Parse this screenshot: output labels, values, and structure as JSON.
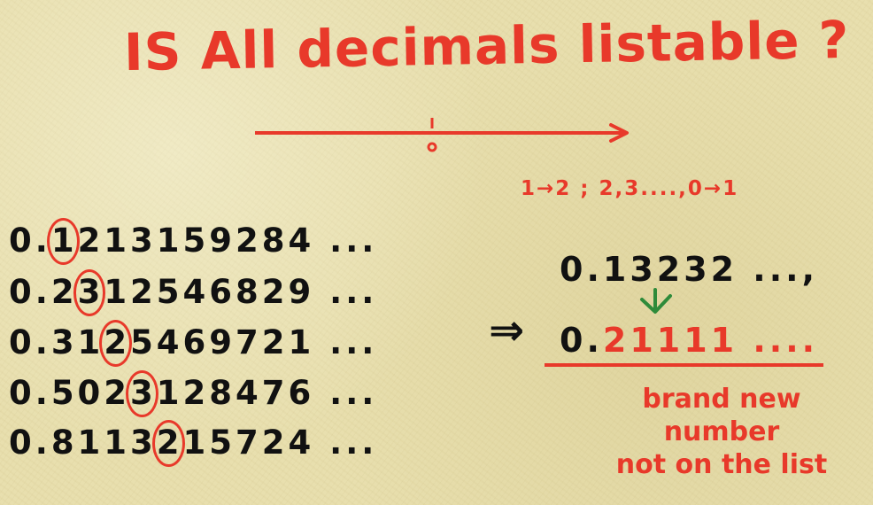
{
  "title": "IS All decimals listable ?",
  "rule": "1→2 ; 2,3....,0→1",
  "list": {
    "rows": [
      {
        "prefix": "0.",
        "circled": "1",
        "after": "213159284 ...",
        "before": ""
      },
      {
        "prefix": "0.",
        "before": "2",
        "circled": "3",
        "after": "12546829 ..."
      },
      {
        "prefix": "0.",
        "before": "31",
        "circled": "2",
        "after": "5469721 ..."
      },
      {
        "prefix": "0.",
        "before": "502",
        "circled": "3",
        "after": "128476 ..."
      },
      {
        "prefix": "0.",
        "before": "8113",
        "circled": "2",
        "after": "15724 ..."
      }
    ]
  },
  "implies": "⇒",
  "diagonal_number": "0.13232 ...,",
  "new_number": {
    "prefix": "0.",
    "first": "2",
    "rest": "1111 ...."
  },
  "caption": {
    "line1": "brand new",
    "line2": "number",
    "line3": "not on the list"
  },
  "colors": {
    "accent": "#e8392a",
    "ink": "#111111",
    "green": "#2e8b3a",
    "paper": "#e8dfae"
  }
}
